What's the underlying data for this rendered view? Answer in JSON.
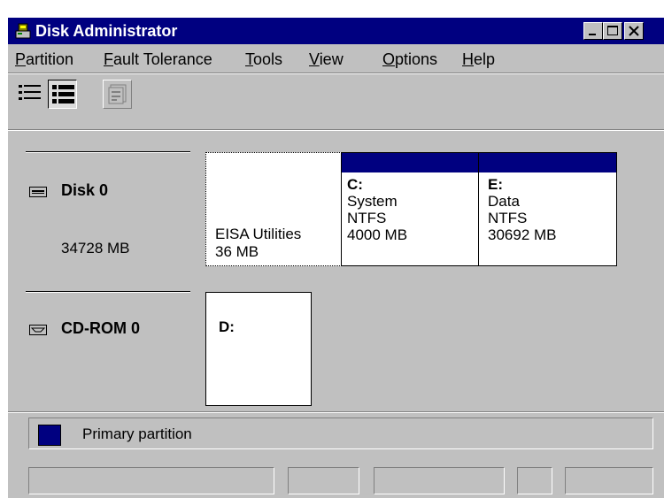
{
  "window": {
    "title": "Disk Administrator",
    "icon": "disk-administrator-app-icon",
    "caption_buttons": [
      "minimize",
      "maximize",
      "close"
    ]
  },
  "menu": {
    "partition": {
      "accel": "P",
      "rest": "artition"
    },
    "fault_tolerance": {
      "accel": "F",
      "rest": "ault Tolerance"
    },
    "tools": {
      "accel": "T",
      "rest": "ools"
    },
    "view": {
      "accel": "V",
      "rest": "iew"
    },
    "options": {
      "accel": "O",
      "rest": "ptions"
    },
    "help": {
      "accel": "H",
      "rest": "elp"
    }
  },
  "toolbar": {
    "buttons": [
      {
        "icon": "volumes-view-icon",
        "state": "normal"
      },
      {
        "icon": "disk-configuration-view-icon",
        "state": "pressed"
      },
      {
        "icon": "properties-icon",
        "state": "disabled"
      }
    ]
  },
  "disks": [
    {
      "name": "Disk 0",
      "size": "34728 MB",
      "icon": "hard-disk-icon",
      "partitions": [
        {
          "label": "EISA Utilities",
          "size": "36 MB",
          "selected": true
        },
        {
          "letter": "C:",
          "volume": "System",
          "fs": "NTFS",
          "size": "4000 MB",
          "type": "Primary partition"
        },
        {
          "letter": "E:",
          "volume": "Data",
          "fs": "NTFS",
          "size": "30692 MB",
          "type": "Primary partition"
        }
      ]
    },
    {
      "name": "CD-ROM 0",
      "icon": "cdrom-drive-icon",
      "partitions": [
        {
          "letter": "D:"
        }
      ]
    }
  ],
  "legend": {
    "primary_partition": "Primary partition",
    "primary_color": "#000080"
  },
  "colors": {
    "title_bar": "#000080",
    "face": "#c0c0c0",
    "partition_header": "#000080"
  }
}
